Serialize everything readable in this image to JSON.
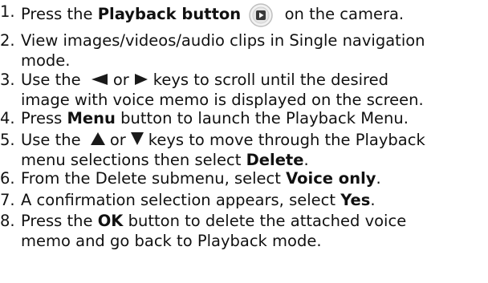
{
  "steps": [
    {
      "num": "1.",
      "a": "Press the ",
      "bold": "Playback button",
      "b": " on the camera.",
      "icon": "playback-button-icon"
    },
    {
      "num": "2.",
      "line1": "View images/videos/audio clips in Single navigation",
      "line2": "mode."
    },
    {
      "num": "3.",
      "a": "Use the ",
      "or": "or",
      "b": "keys to scroll until the desired",
      "line2": "image with voice memo is displayed on the screen.",
      "icons": [
        "left-arrow-icon",
        "right-arrow-icon"
      ]
    },
    {
      "num": "4.",
      "a": "Press ",
      "bold": "Menu",
      "b": " button to launch the Playback Menu."
    },
    {
      "num": "5.",
      "a": "Use the ",
      "or": "or",
      "b": "keys to move through the Playback",
      "line2a": "menu selections then select ",
      "line2bold": "Delete",
      "line2b": ".",
      "icons": [
        "up-arrow-icon",
        "down-arrow-icon"
      ]
    },
    {
      "num": "6.",
      "a": "From the Delete submenu, select ",
      "bold": "Voice only",
      "b": "."
    },
    {
      "num": "7.",
      "a": "A confirmation selection appears, select ",
      "bold": "Yes",
      "b": "."
    },
    {
      "num": "8.",
      "a": "Press the ",
      "bold": "OK",
      "b": " button to delete the attached voice",
      "line2": "memo and go back to Playback mode."
    }
  ],
  "colors": {
    "text": "#111111",
    "icon_fill": "#3a3a3a",
    "icon_ring": "#bfbfbf"
  }
}
